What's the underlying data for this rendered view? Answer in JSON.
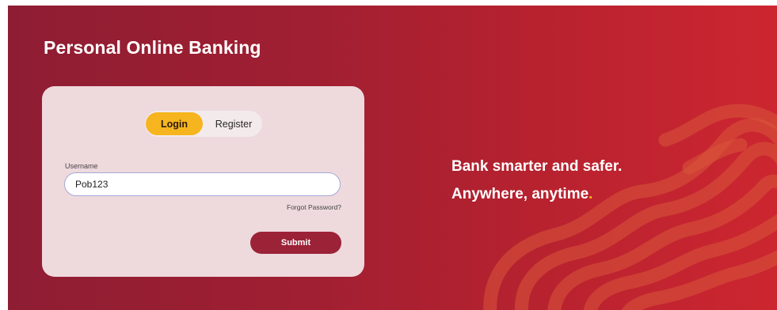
{
  "hero": {
    "title": "Personal Online Banking",
    "tagline_line1": "Bank smarter and safer.",
    "tagline_line2": "Anywhere, anytime",
    "tagline_dot": "."
  },
  "login_card": {
    "tabs": [
      {
        "label": "Login",
        "active": true
      },
      {
        "label": "Register",
        "active": false
      }
    ],
    "username_label": "Username",
    "username_value": "Pob123",
    "forgot_password_label": "Forgot Password?",
    "submit_label": "Submit"
  },
  "colors": {
    "brand_red": "#a11f32",
    "accent_yellow": "#f6b51e",
    "button_maroon": "#9c2238",
    "card_bg": "#eed9dd"
  }
}
